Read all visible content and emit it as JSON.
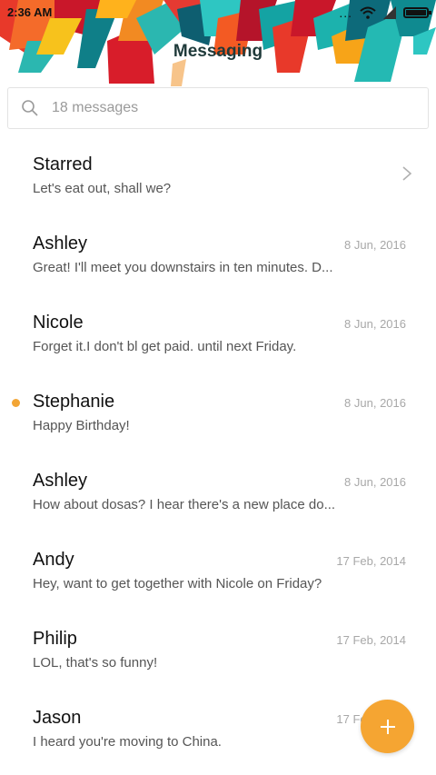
{
  "status_bar": {
    "time": "2:36 AM",
    "more": "..."
  },
  "header": {
    "title": "Messaging"
  },
  "search": {
    "placeholder": "18 messages"
  },
  "conversations": [
    {
      "name": "Starred",
      "preview": "Let's eat out, shall we?",
      "date": "",
      "unread": false,
      "type": "folder"
    },
    {
      "name": "Ashley",
      "preview": "Great! I'll meet you downstairs in ten minutes. D...",
      "date": "8 Jun, 2016",
      "unread": false
    },
    {
      "name": "Nicole",
      "preview": "Forget it.I don't bl get paid. until next Friday.",
      "date": "8 Jun, 2016",
      "unread": false
    },
    {
      "name": "Stephanie",
      "preview": "Happy Birthday!",
      "date": "8 Jun, 2016",
      "unread": true
    },
    {
      "name": "Ashley",
      "preview": "How about dosas? I hear there's a new place do...",
      "date": "8 Jun, 2016",
      "unread": false
    },
    {
      "name": "Andy",
      "preview": "Hey, want to get together with Nicole on Friday?",
      "date": "17 Feb, 2014",
      "unread": false
    },
    {
      "name": "Philip",
      "preview": "LOL, that's so funny!",
      "date": "17 Feb, 2014",
      "unread": false
    },
    {
      "name": "Jason",
      "preview": "I heard you're moving to China.",
      "date": "17 Feb, 2014",
      "unread": false
    }
  ],
  "fab": {
    "icon": "plus-icon",
    "color": "#f5a532"
  },
  "colors": {
    "accent": "#f5a532",
    "unread_dot": "#f2a535"
  }
}
